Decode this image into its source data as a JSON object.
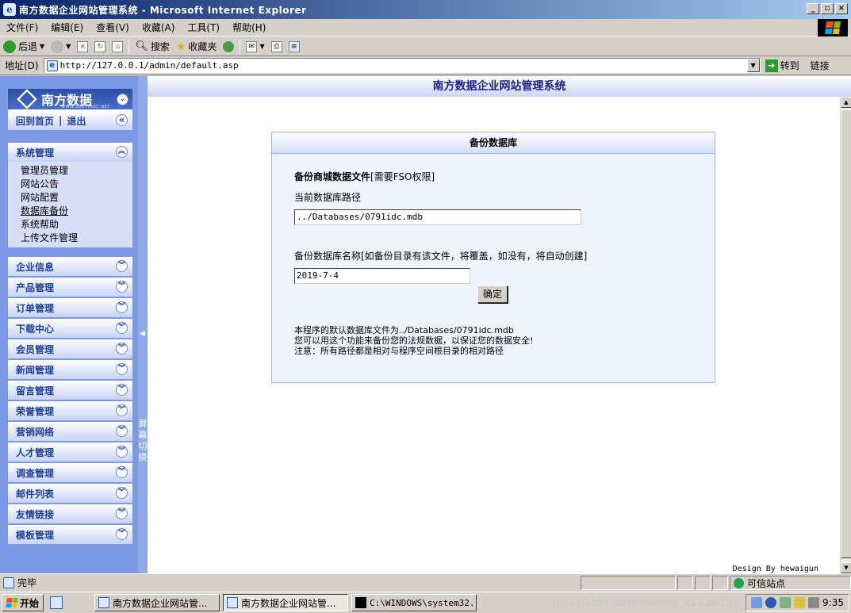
{
  "window": {
    "title": "南方数据企业网站管理系统 - Microsoft Internet Explorer"
  },
  "menu": [
    "文件(F)",
    "编辑(E)",
    "查看(V)",
    "收藏(A)",
    "工具(T)",
    "帮助(H)"
  ],
  "toolbar": {
    "back": "后退",
    "search": "搜索",
    "favorites": "收藏夹"
  },
  "address": {
    "label": "地址(D)",
    "url": "http://127.0.0.1/admin/default.asp",
    "go": "转到",
    "links": "链接"
  },
  "sidebar": {
    "logo": "南方数据",
    "logo_sub": "WWW.SOUTHIDC.NET",
    "home": "回到首页",
    "sep": "|",
    "logout": "退出",
    "system_group": {
      "title": "系统管理",
      "items": [
        "管理员管理",
        "网站公告",
        "网站配置",
        "数据库备份",
        "系统帮助",
        "上传文件管理"
      ]
    },
    "groups": [
      "企业信息",
      "产品管理",
      "订单管理",
      "下载中心",
      "会员管理",
      "新闻管理",
      "留言管理",
      "荣誉管理",
      "营销网络",
      "人才管理",
      "调查管理",
      "邮件列表",
      "友情链接",
      "模板管理"
    ],
    "toggle_label": "屏幕切换"
  },
  "main": {
    "site_title": "南方数据企业网站管理系统",
    "panel": {
      "title": "备份数据库",
      "section_bold": "备份商城数据文件",
      "section_note": "[需要FSO权限]",
      "current_path_label": "当前数据库路径",
      "current_path_value": "../Databases/0791idc.mdb",
      "backup_name_label": "备份数据库名称[如备份目录有该文件，将覆盖，如没有，将自动创建]",
      "backup_name_value": "2019-7-4",
      "confirm": "确定",
      "notes": [
        "本程序的默认数据库文件为../Databases/0791idc.mdb",
        "您可以用这个功能来备份您的法规数据，以保证您的数据安全!",
        "注意：所有路径都是相对与程序空间根目录的相对路径"
      ]
    },
    "design": "Design By hewaigun"
  },
  "status": {
    "text": "完毕",
    "zone": "可信站点"
  },
  "taskbar": {
    "start": "开始",
    "tasks": [
      "南方数据企业网站管...",
      "南方数据企业网站管...",
      "C:\\WINDOWS\\system32..."
    ],
    "clock": "9:35",
    "watermark": "https://blog.csdn.net/qq_41838190"
  }
}
